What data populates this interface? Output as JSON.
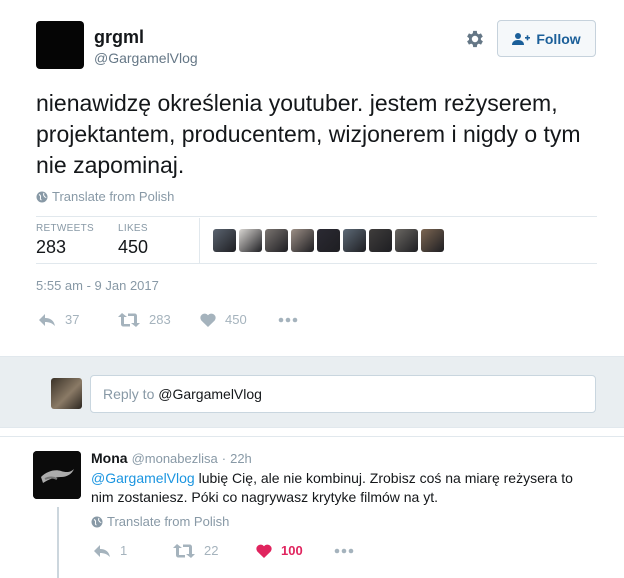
{
  "tweet": {
    "author_name": "grgml",
    "author_handle": "@GargamelVlog",
    "follow_label": "Follow",
    "text": "nienawidzę określenia youtuber. jestem reżyserem, projektantem, producentem, wizjonerem i nigdy o tym nie zapominaj.",
    "translate_label": "Translate from Polish",
    "stats": {
      "retweets_label": "RETWEETS",
      "retweets_value": "283",
      "likes_label": "LIKES",
      "likes_value": "450"
    },
    "timestamp": "5:55 am - 9 Jan 2017",
    "actions": {
      "reply_count": "37",
      "retweet_count": "283",
      "like_count": "450"
    },
    "liker_colors": [
      "#5b6470",
      "#d9d6d2",
      "#7a7470",
      "#9c8f86",
      "#2b2a33",
      "#5d6a77",
      "#3f3d3c",
      "#6a6762",
      "#7c6652"
    ]
  },
  "reply_box": {
    "placeholder_prefix": "Reply to ",
    "placeholder_mention": "@GargamelVlog"
  },
  "comment": {
    "author_name": "Mona",
    "author_handle": "@monabezlisa",
    "separator": "·",
    "time": "22h",
    "mention": "@GargamelVlog",
    "text": " lubię Cię, ale nie kombinuj. Zrobisz coś na miarę reżysera to nim zostaniesz. Póki co nagrywasz krytyke filmów na yt.",
    "translate_label": "Translate from Polish",
    "actions": {
      "reply_count": "1",
      "retweet_count": "22",
      "like_count": "100"
    }
  },
  "colors": {
    "accent": "#1b95e0",
    "like_active": "#e0245e",
    "muted": "#8899a6"
  }
}
